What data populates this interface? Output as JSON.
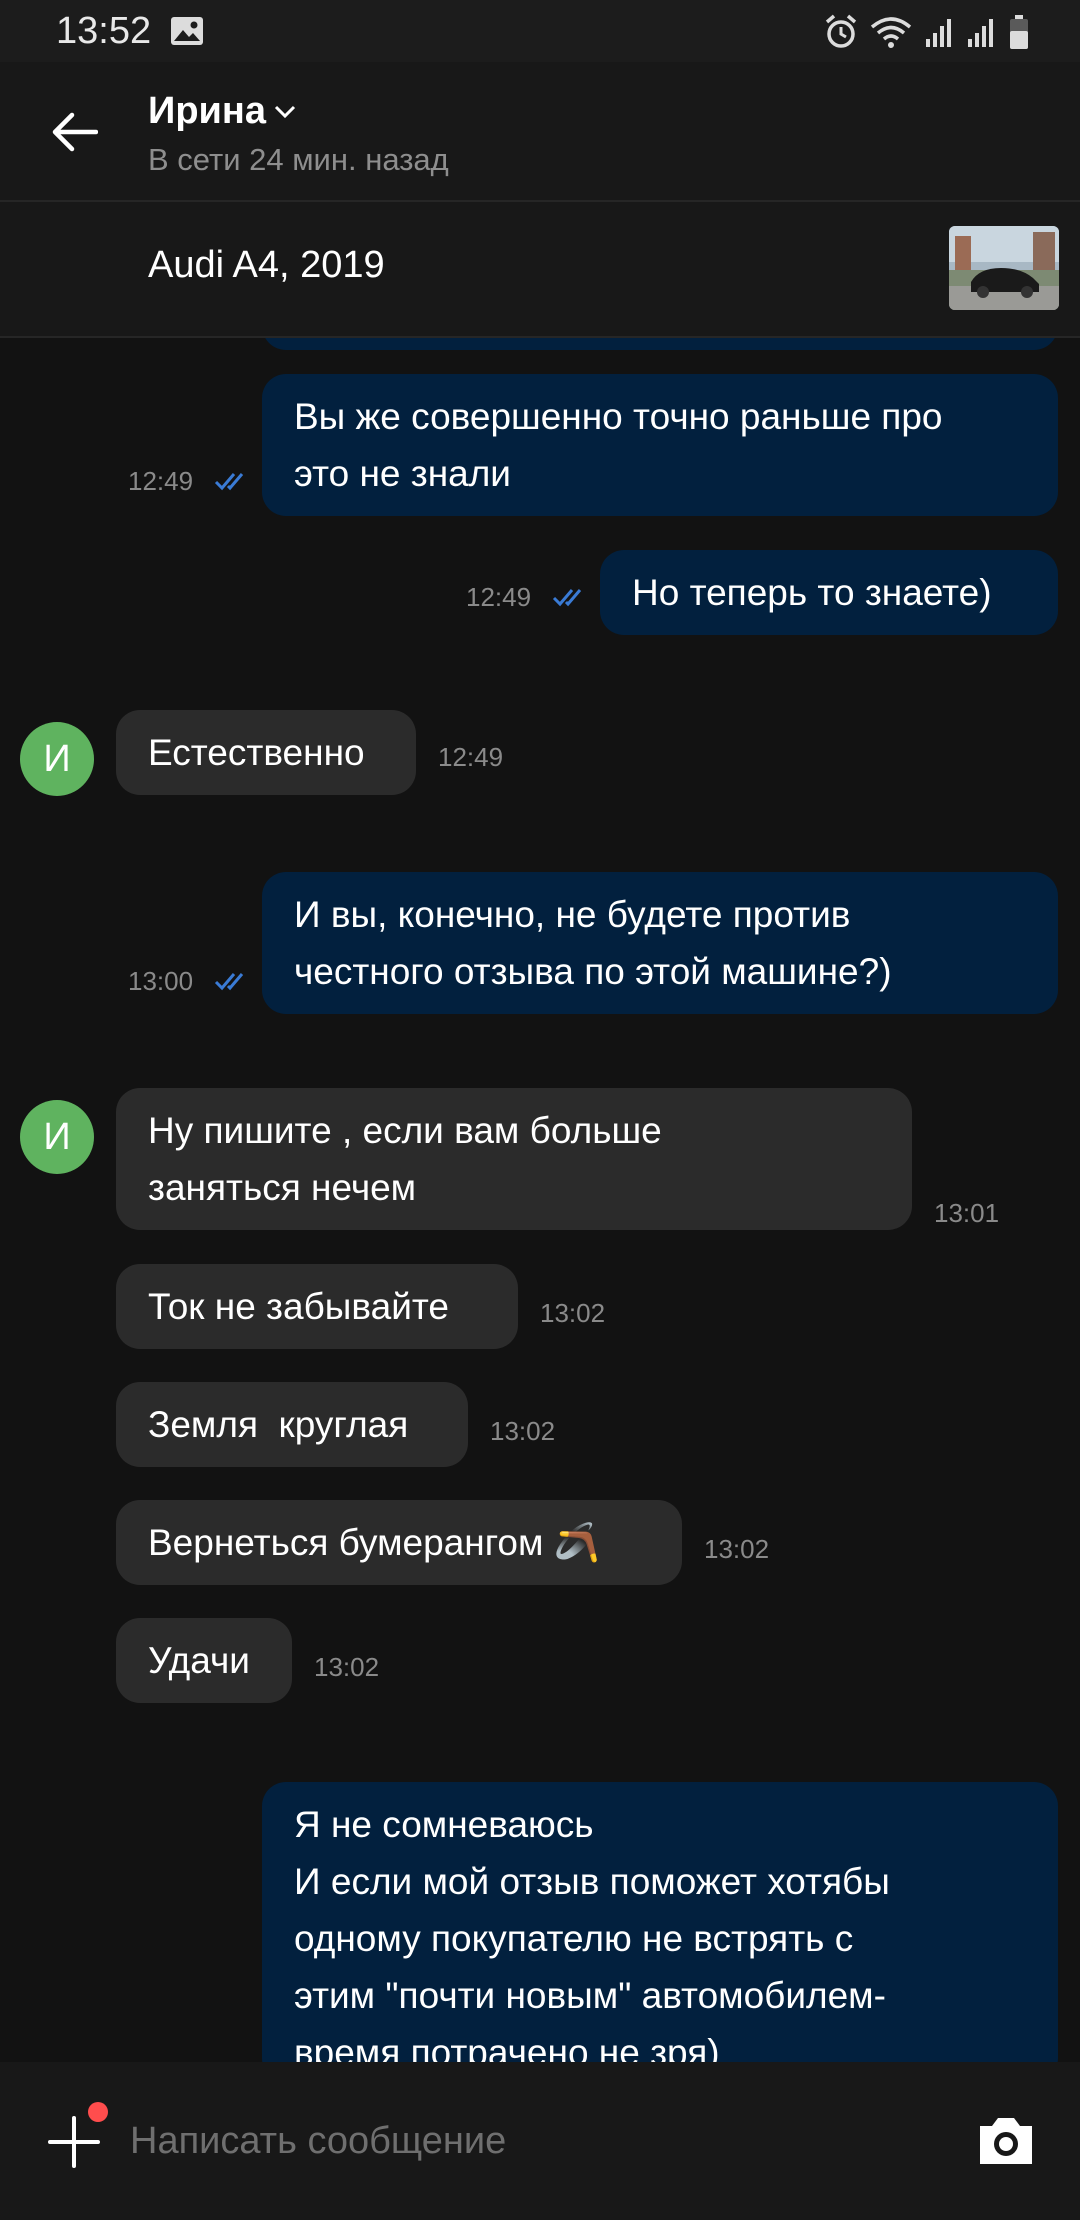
{
  "status_bar": {
    "time": "13:52"
  },
  "header": {
    "contact_name": "Ирина",
    "contact_status": "В сети 24 мин. назад"
  },
  "listing": {
    "title": "Audi A4, 2019"
  },
  "messages": [
    {
      "direction": "out",
      "lines": [
        "Вы же совершенно точно раньше про",
        "это не знали"
      ],
      "time": "12:49",
      "read": true
    },
    {
      "direction": "out",
      "lines": [
        "Но теперь то знаете)"
      ],
      "time": "12:49",
      "read": true
    },
    {
      "direction": "in",
      "lines": [
        "Естественно"
      ],
      "time": "12:49",
      "avatar": "И"
    },
    {
      "direction": "out",
      "lines": [
        "И вы, конечно, не будете против",
        "честного отзыва по этой машине?)"
      ],
      "time": "13:00",
      "read": true
    },
    {
      "direction": "in",
      "lines": [
        "Ну пишите , если вам больше",
        "заняться нечем"
      ],
      "time": "13:01",
      "avatar": "И"
    },
    {
      "direction": "in",
      "lines": [
        "Ток не забывайте"
      ],
      "time": "13:02"
    },
    {
      "direction": "in",
      "lines": [
        "Земля  круглая"
      ],
      "time": "13:02"
    },
    {
      "direction": "in",
      "lines": [
        "Вернеться бумерангом 🪃"
      ],
      "time": "13:02"
    },
    {
      "direction": "in",
      "lines": [
        "Удачи"
      ],
      "time": "13:02"
    },
    {
      "direction": "out",
      "lines": [
        "Я не сомневаюсь",
        "И если мой отзыв поможет хотябы",
        "одному покупателю не встрять с",
        "этим \"почти новым\" автомобилем-",
        "время потрачено не зря)"
      ]
    }
  ],
  "composer": {
    "placeholder": "Написать сообщение"
  },
  "colors": {
    "outgoing_bubble": "#02203e",
    "incoming_bubble": "#2b2b2b",
    "avatar": "#5fb35f",
    "read_ticks": "#3a7bd5",
    "badge": "#ff4d4d"
  }
}
